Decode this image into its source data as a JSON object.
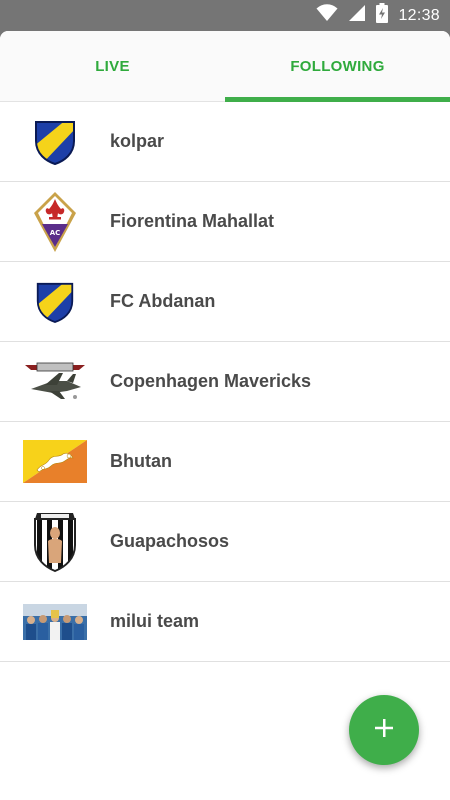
{
  "status_bar": {
    "time": "12:38",
    "icons": [
      "wifi-icon",
      "cellular-signal-icon",
      "battery-charging-icon"
    ]
  },
  "tabs": [
    {
      "label": "LIVE",
      "active": false
    },
    {
      "label": "FOLLOWING",
      "active": true
    }
  ],
  "teams": [
    {
      "name": "kolpar",
      "logo": "blue-yellow-shield-logo"
    },
    {
      "name": "Fiorentina Mahallat",
      "logo": "fiorentina-lily-crest-logo"
    },
    {
      "name": "FC Abdanan",
      "logo": "blue-yellow-shield-logo"
    },
    {
      "name": "Copenhagen Mavericks",
      "logo": "top-gun-jet-logo"
    },
    {
      "name": "Bhutan",
      "logo": "bhutan-flag-logo"
    },
    {
      "name": "Guapachosos",
      "logo": "striped-shield-figure-logo"
    },
    {
      "name": "milui team",
      "logo": "team-photo-logo"
    }
  ],
  "fab": {
    "icon": "plus-icon"
  },
  "colors": {
    "accent": "#3fae4a",
    "tab_text": "#2faa3c",
    "status_bar": "#757575",
    "team_text": "#4a4a4a"
  }
}
